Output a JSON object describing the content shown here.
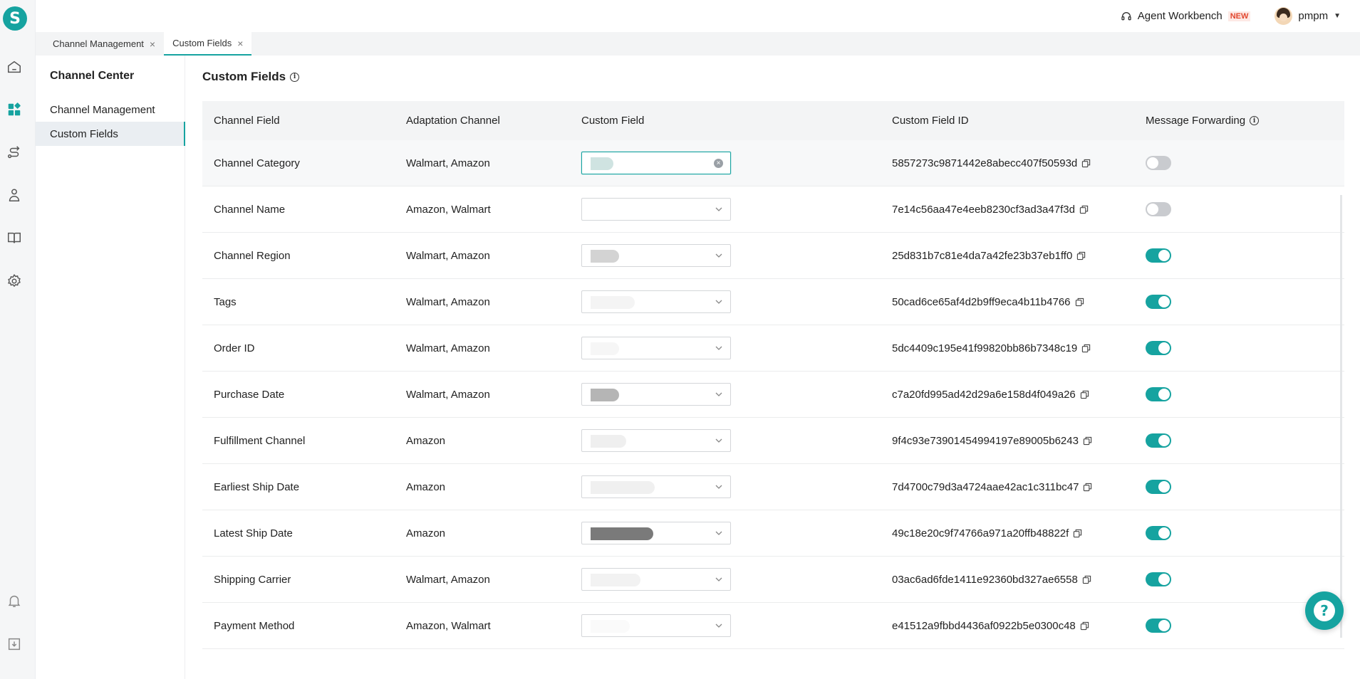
{
  "app": {
    "logo_letter": "S",
    "accent_color": "#16a3a0"
  },
  "rail": {
    "icons": [
      "home-icon",
      "apps-icon",
      "routes-icon",
      "user-money-icon",
      "book-icon",
      "gear-icon",
      "bell-icon",
      "download-icon"
    ]
  },
  "topbar": {
    "workbench_label": "Agent Workbench",
    "new_badge": "NEW",
    "username": "pmpm"
  },
  "tabs": [
    {
      "label": "Channel Management",
      "active": false
    },
    {
      "label": "Custom Fields",
      "active": true
    }
  ],
  "subnav": {
    "title": "Channel Center",
    "items": [
      {
        "label": "Channel Management",
        "active": false
      },
      {
        "label": "Custom Fields",
        "active": true
      }
    ]
  },
  "page": {
    "title": "Custom Fields"
  },
  "table": {
    "columns": [
      "Channel Field",
      "Adaptation Channel",
      "Custom Field",
      "Custom Field ID",
      "Message Forwarding"
    ],
    "rows": [
      {
        "field": "Channel Category",
        "channel": "Walmart, Amazon",
        "id": "5857273c9871442e8abecc407f50593d",
        "forwarding": false,
        "focused": true
      },
      {
        "field": "Channel Name",
        "channel": "Amazon, Walmart",
        "id": "7e14c56aa47e4eeb8230cf3ad3a47f3d",
        "forwarding": false
      },
      {
        "field": "Channel Region",
        "channel": "Walmart, Amazon",
        "id": "25d831b7c81e4da7a42fe23b37eb1ff0",
        "forwarding": true
      },
      {
        "field": "Tags",
        "channel": "Walmart, Amazon",
        "id": "50cad6ce65af4d2b9ff9eca4b11b4766",
        "forwarding": true
      },
      {
        "field": "Order ID",
        "channel": "Walmart, Amazon",
        "id": "5dc4409c195e41f99820bb86b7348c19",
        "forwarding": true
      },
      {
        "field": "Purchase Date",
        "channel": "Walmart, Amazon",
        "id": "c7a20fd995ad42d29a6e158d4f049a26",
        "forwarding": true
      },
      {
        "field": "Fulfillment Channel",
        "channel": "Amazon",
        "id": "9f4c93e73901454994197e89005b6243",
        "forwarding": true
      },
      {
        "field": "Earliest Ship Date",
        "channel": "Amazon",
        "id": "7d4700c79d3a4724aae42ac1c311bc47",
        "forwarding": true
      },
      {
        "field": "Latest Ship Date",
        "channel": "Amazon",
        "id": "49c18e20c9f74766a971a20ffb48822f",
        "forwarding": true
      },
      {
        "field": "Shipping Carrier",
        "channel": "Walmart, Amazon",
        "id": "03ac6ad6fde1411e92360bd327ae6558",
        "forwarding": true
      },
      {
        "field": "Payment Method",
        "channel": "Amazon, Walmart",
        "id": "e41512a9fbbd4436af0922b5e0300c48",
        "forwarding": true
      }
    ]
  }
}
